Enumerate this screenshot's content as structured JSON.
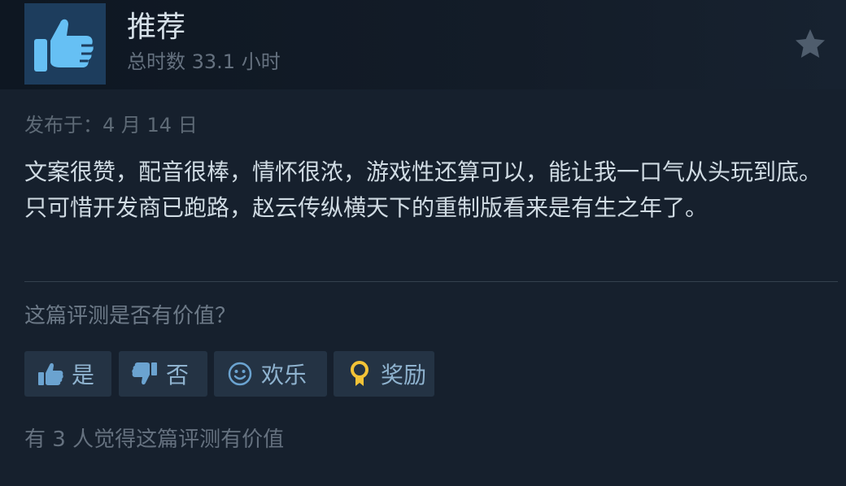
{
  "review": {
    "recommendation": "推荐",
    "hours": "总时数 33.1 小时",
    "posted": "发布于：4 月 14 日",
    "text": "文案很赞，配音很棒，情怀很浓，游戏性还算可以，能让我一口气从头玩到底。只可惜开发商已跑路，赵云传纵横天下的重制版看来是有生之年了。"
  },
  "helpful": {
    "question": "这篇评测是否有价值？",
    "yes_label": "是",
    "no_label": "否",
    "funny_label": "欢乐",
    "award_label": "奖励",
    "found_helpful": "有 3 人觉得这篇评测有价值"
  },
  "icons": {
    "recommend": "thumbs-up-icon",
    "favorite": "star-icon",
    "yes": "thumbs-up-icon",
    "no": "thumbs-down-icon",
    "funny": "smiley-icon",
    "award": "award-medal-icon"
  },
  "colors": {
    "background": "#16202d",
    "thumb_box": "#1d3d5d",
    "thumb_icon": "#66c0f4",
    "button_bg": "#243344",
    "button_text": "#8fb3cf",
    "award_gold": "#f3c337"
  }
}
